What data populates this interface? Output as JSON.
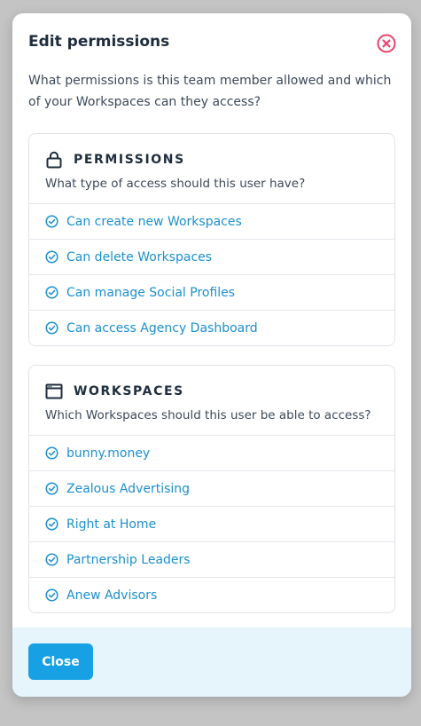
{
  "dialog": {
    "title": "Edit permissions",
    "intro": "What permissions is this team member allowed and which of your Workspaces can they access?"
  },
  "permissions": {
    "icon": "lock-icon",
    "heading": "PERMISSIONS",
    "subtitle": "What type of access should this user have?",
    "items": [
      {
        "label": "Can create new Workspaces",
        "checked": true
      },
      {
        "label": "Can delete Workspaces",
        "checked": true
      },
      {
        "label": "Can manage Social Profiles",
        "checked": true
      },
      {
        "label": "Can access Agency Dashboard",
        "checked": true
      }
    ]
  },
  "workspaces": {
    "icon": "browser-window-icon",
    "heading": "WORKSPACES",
    "subtitle": "Which Workspaces should this user be able to access?",
    "items": [
      {
        "label": "bunny.money",
        "checked": true
      },
      {
        "label": "Zealous Advertising",
        "checked": true
      },
      {
        "label": "Right at Home",
        "checked": true
      },
      {
        "label": "Partnership Leaders",
        "checked": true
      },
      {
        "label": "Anew Advisors",
        "checked": true
      }
    ]
  },
  "footer": {
    "close_label": "Close"
  },
  "colors": {
    "accent": "#18a0e5",
    "link": "#1b8fcf",
    "close_icon": "#e8416a",
    "footer_bg": "#e6f5fc"
  }
}
